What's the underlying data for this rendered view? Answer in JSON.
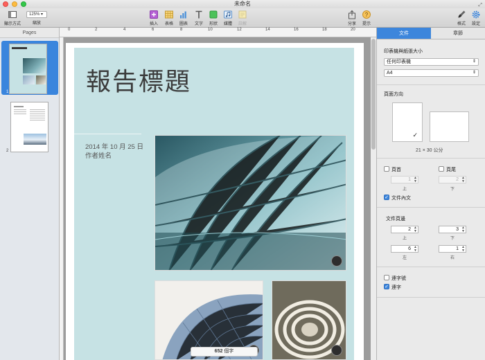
{
  "window": {
    "title": "未命名"
  },
  "toolbar": {
    "view_label": "顯示方式",
    "zoom_label": "縮放",
    "zoom_value": "125%",
    "insert_label": "插入",
    "table_label": "表格",
    "chart_label": "圖表",
    "text_label": "文字",
    "shape_label": "形狀",
    "media_label": "媒體",
    "comment_label": "註解",
    "share_label": "分享",
    "tips_label": "提示",
    "format_label": "格式",
    "setup_label": "設定"
  },
  "sidebar": {
    "header": "Pages",
    "pages": [
      "1",
      "2"
    ]
  },
  "ruler": {
    "ticks": [
      "0",
      "2",
      "4",
      "6",
      "8",
      "10",
      "12",
      "14",
      "16",
      "18",
      "20"
    ]
  },
  "document": {
    "title": "報告標題",
    "date": "2014 年 10 月 25 日",
    "author": "作者姓名",
    "word_count_number": "652",
    "word_count_unit": "個字"
  },
  "inspector": {
    "tabs": [
      "文件",
      "章節"
    ],
    "active_tab": 0,
    "printer_paper_label": "印表機與紙張大小",
    "printer_value": "任何印表機",
    "paper_value": "A4",
    "orientation_label": "頁面方向",
    "paper_dims": "21 × 30 公分",
    "header_label": "頁首",
    "footer_label": "頁尾",
    "header_checked": false,
    "footer_checked": false,
    "header_value": "1",
    "footer_value": "2",
    "top_cap": "上",
    "bottom_cap": "下",
    "body_label": "文件內文",
    "body_checked": true,
    "margins_label": "文件頁邊",
    "margin_top": "2",
    "margin_bottom": "3",
    "margin_left": "6",
    "margin_right": "1",
    "left_cap": "左",
    "right_cap": "右",
    "hyphen_label": "連字號",
    "ligature_label": "連字",
    "hyphen_checked": false,
    "ligature_checked": true
  },
  "colors": {
    "accent": "#3d86dc",
    "cover_bg": "#c6e2e4"
  }
}
